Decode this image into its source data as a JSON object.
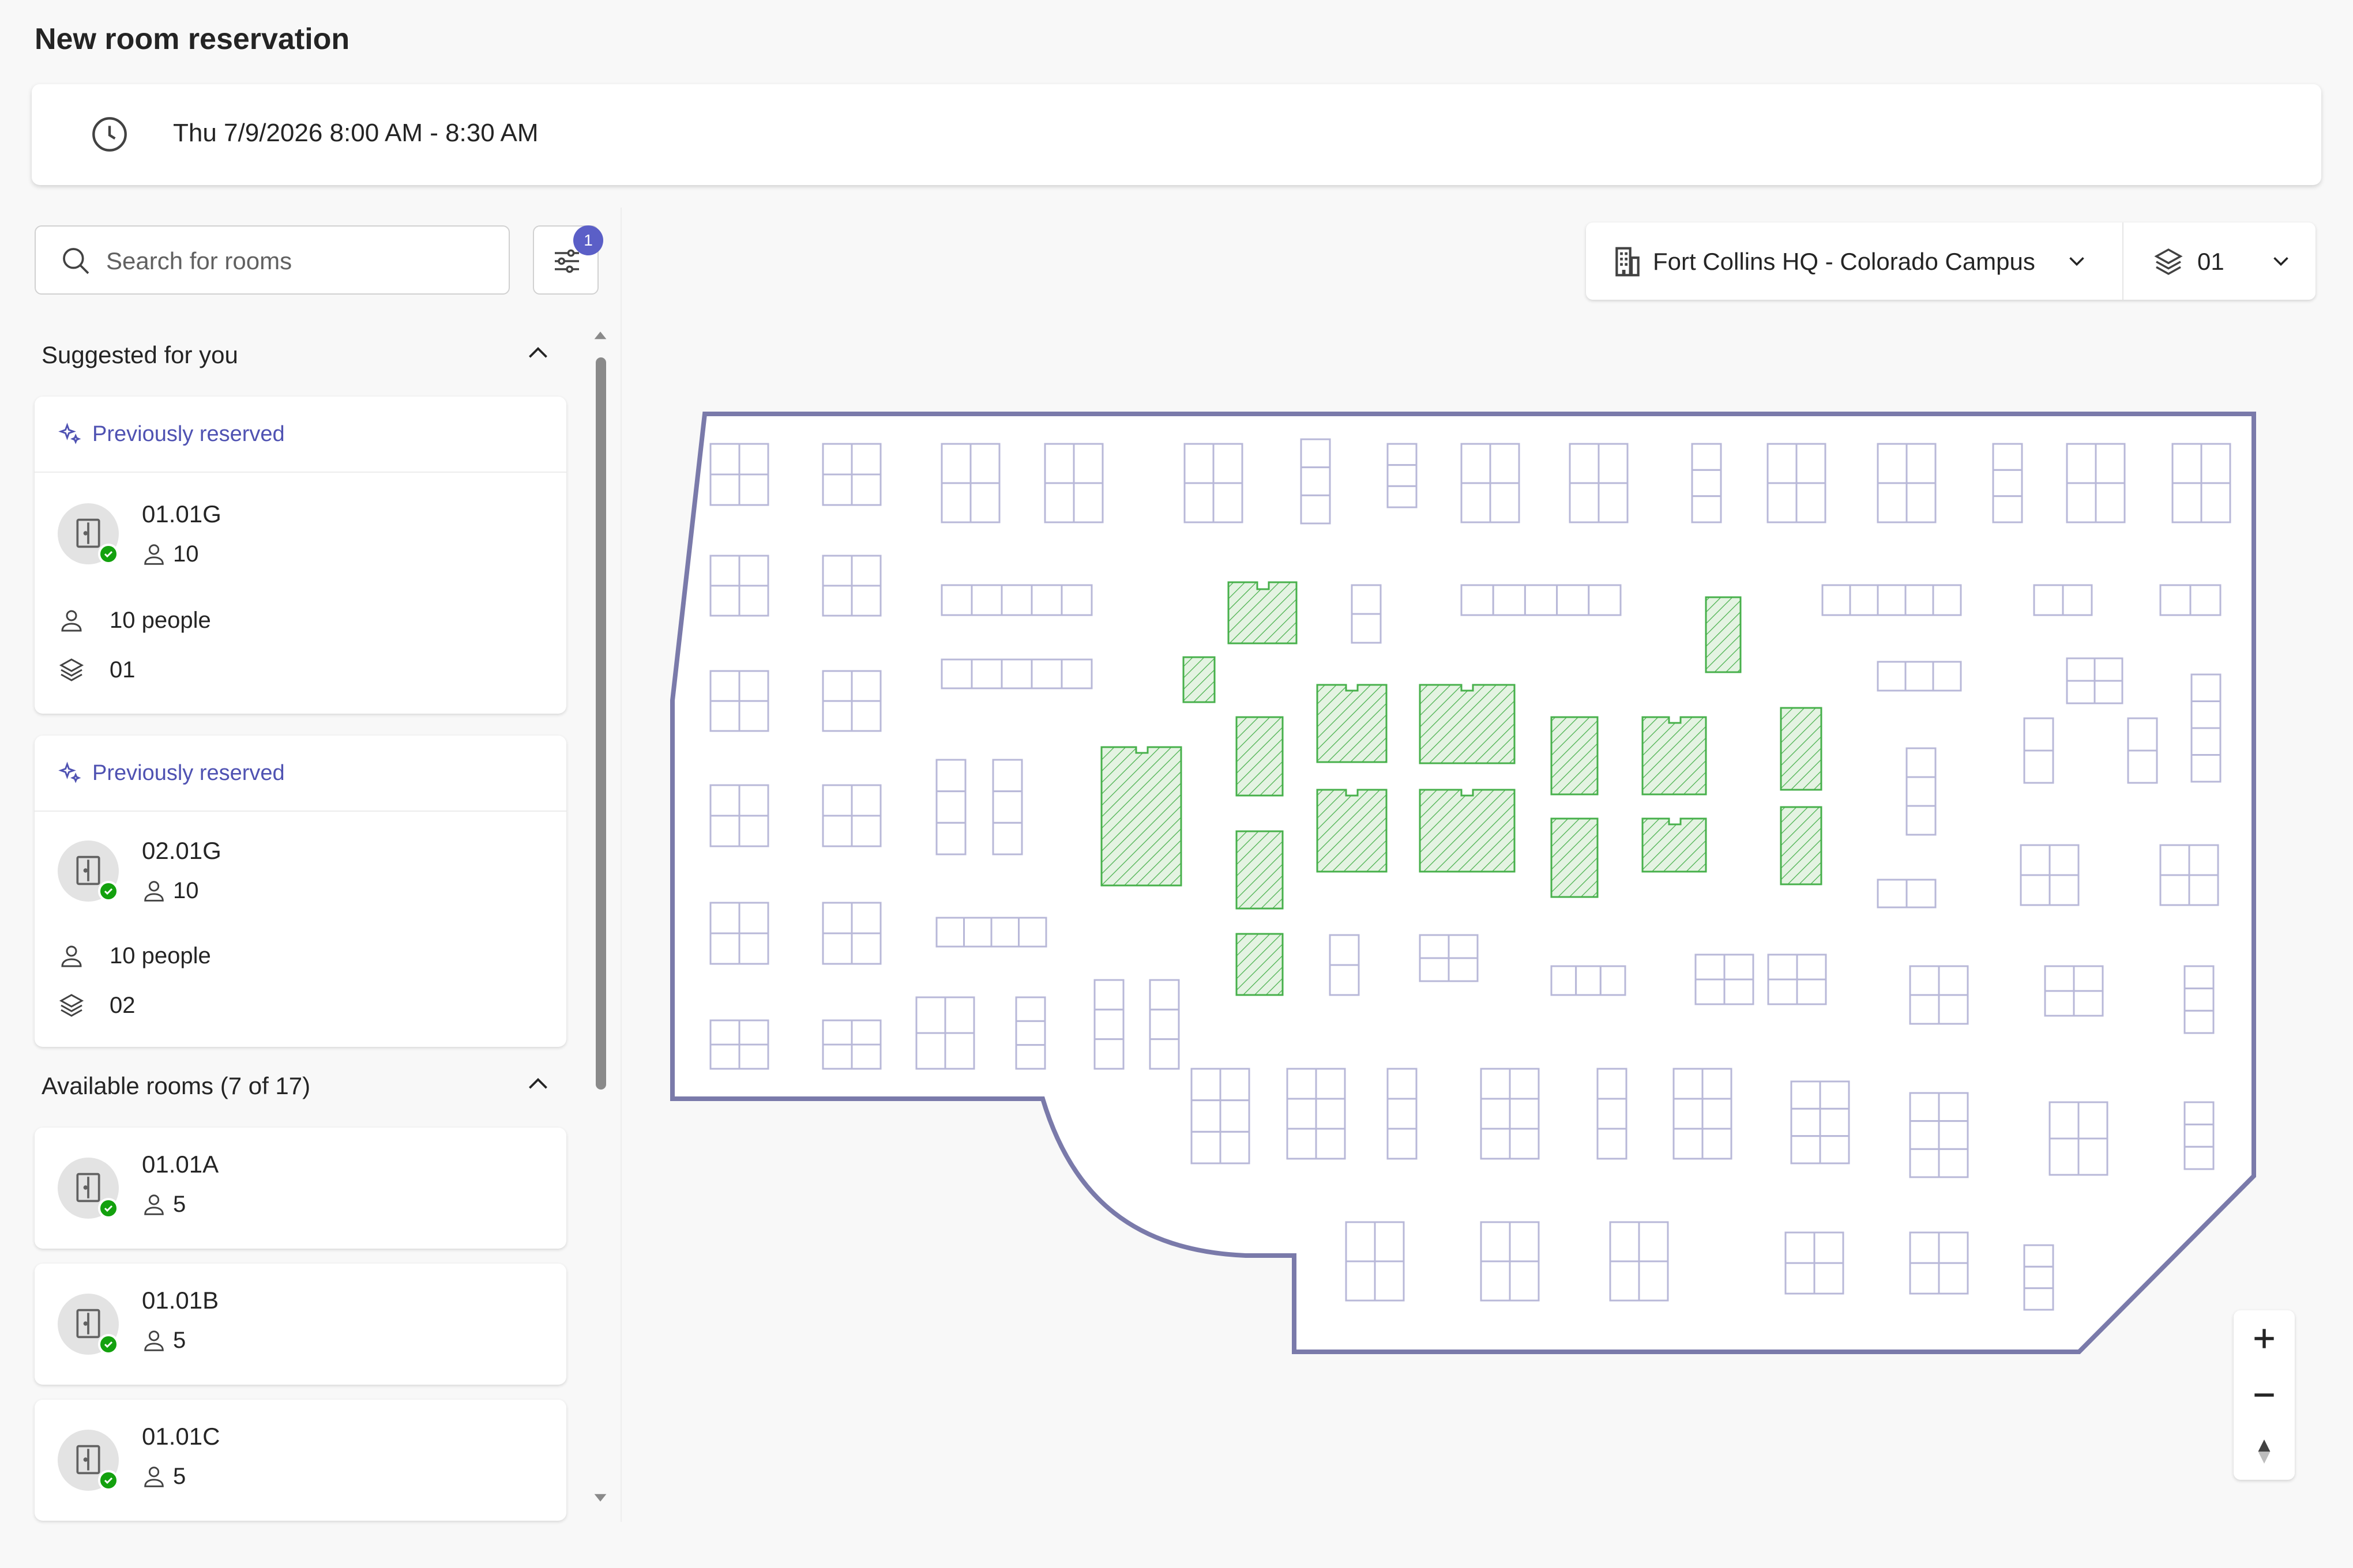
{
  "page": {
    "title": "New room reservation"
  },
  "time": {
    "label": "Thu 7/9/2026 8:00 AM - 8:30 AM"
  },
  "search": {
    "placeholder": "Search for rooms",
    "filter_count": "1"
  },
  "suggested": {
    "header": "Suggested for you",
    "cards": [
      {
        "tag": "Previously reserved",
        "name": "01.01G",
        "capacity": "10",
        "people": "10 people",
        "floor": "01"
      },
      {
        "tag": "Previously reserved",
        "name": "02.01G",
        "capacity": "10",
        "people": "10 people",
        "floor": "02"
      }
    ]
  },
  "available": {
    "header": "Available rooms (7 of 17)",
    "rooms": [
      {
        "name": "01.01A",
        "capacity": "5"
      },
      {
        "name": "01.01B",
        "capacity": "5"
      },
      {
        "name": "01.01C",
        "capacity": "5"
      }
    ]
  },
  "location": {
    "building": "Fort Collins HQ - Colorado Campus",
    "floor": "01"
  },
  "colors": {
    "accent": "#5b5fc7",
    "available_room": "#47b04b",
    "room_outline": "#b8b8d8",
    "floorplan_outline": "#7a7aaa"
  },
  "icons": [
    "clock-icon",
    "search-icon",
    "filter-icon",
    "chevron-up-icon",
    "sparkle-icon",
    "door-icon",
    "person-icon",
    "layers-icon",
    "building-icon",
    "chevron-down-icon",
    "zoom-in-icon",
    "zoom-out-icon",
    "compass-icon"
  ]
}
